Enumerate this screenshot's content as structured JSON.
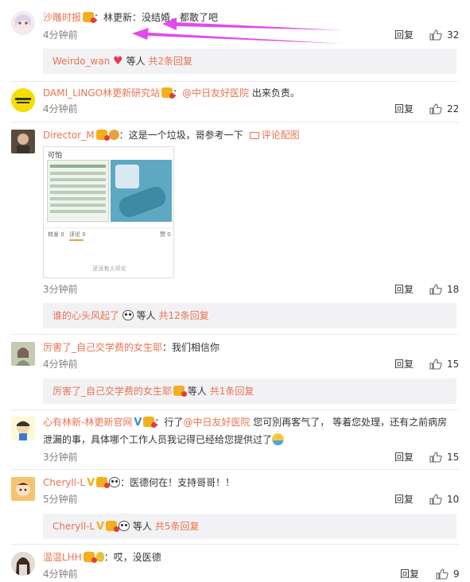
{
  "labels": {
    "reply": "回复",
    "others_suffix": "等人",
    "pic_link": "评论配图"
  },
  "colors": {
    "username": "#eb7350",
    "arrow": "#e040e8",
    "subbox_bg": "#f2f2f5"
  },
  "comments": [
    {
      "user": "沙雕时报",
      "sep": "：",
      "text": "林更新：没结婚，都散了吧",
      "time": "4分钟前",
      "likes": "32",
      "thread": {
        "user": "Weirdo_wan",
        "others": "等人",
        "count": "共2条回复"
      }
    },
    {
      "user": "DAMI_LINGO林更新研究站",
      "sep": "：",
      "mention": "@中日友好医院",
      "text": " 出来负责。",
      "time": "4分钟前",
      "likes": "22"
    },
    {
      "user": "Director_M",
      "sep": "：",
      "text": "这是一个垃圾，哥参考一下",
      "time": "3分钟前",
      "likes": "18",
      "attachment": {
        "title": "可怕",
        "tab1": "转发 0",
        "tab2": "评论 0",
        "tab3": "赞 0",
        "footer": "还没有人评论"
      },
      "thread": {
        "user": "谁的心头风起了",
        "others": "等人",
        "count": "共12条回复"
      }
    },
    {
      "user": "厉害了_自己交学费的女生耶",
      "sep": "：",
      "text": "我们相信你",
      "time": "4分钟前",
      "likes": "15",
      "thread": {
        "user": "厉害了_自己交学费的女生耶",
        "others": "等人",
        "count": "共1条回复"
      }
    },
    {
      "user": "心有林新-林更新官网",
      "sep": "：",
      "text_pre": "行了",
      "mention": "@中日友好医院",
      "text": " 您可別再客气了， 等着您处理，还有之前病房",
      "text_line2": "泄漏的事，具体哪个工作人员我记得已经给您提供过了",
      "time": "3分钟前",
      "likes": "15"
    },
    {
      "user": "Cheryll-L",
      "sep": "：",
      "text": "医德何在！支持哥哥！！",
      "time": "5分钟前",
      "likes": "10",
      "thread": {
        "user": "Cheryll-L",
        "others": "等人",
        "count": "共5条回复"
      }
    },
    {
      "user": "温温LHH",
      "sep": "：",
      "text": "哎，没医德",
      "time": "4分钟前",
      "likes": "9"
    }
  ]
}
